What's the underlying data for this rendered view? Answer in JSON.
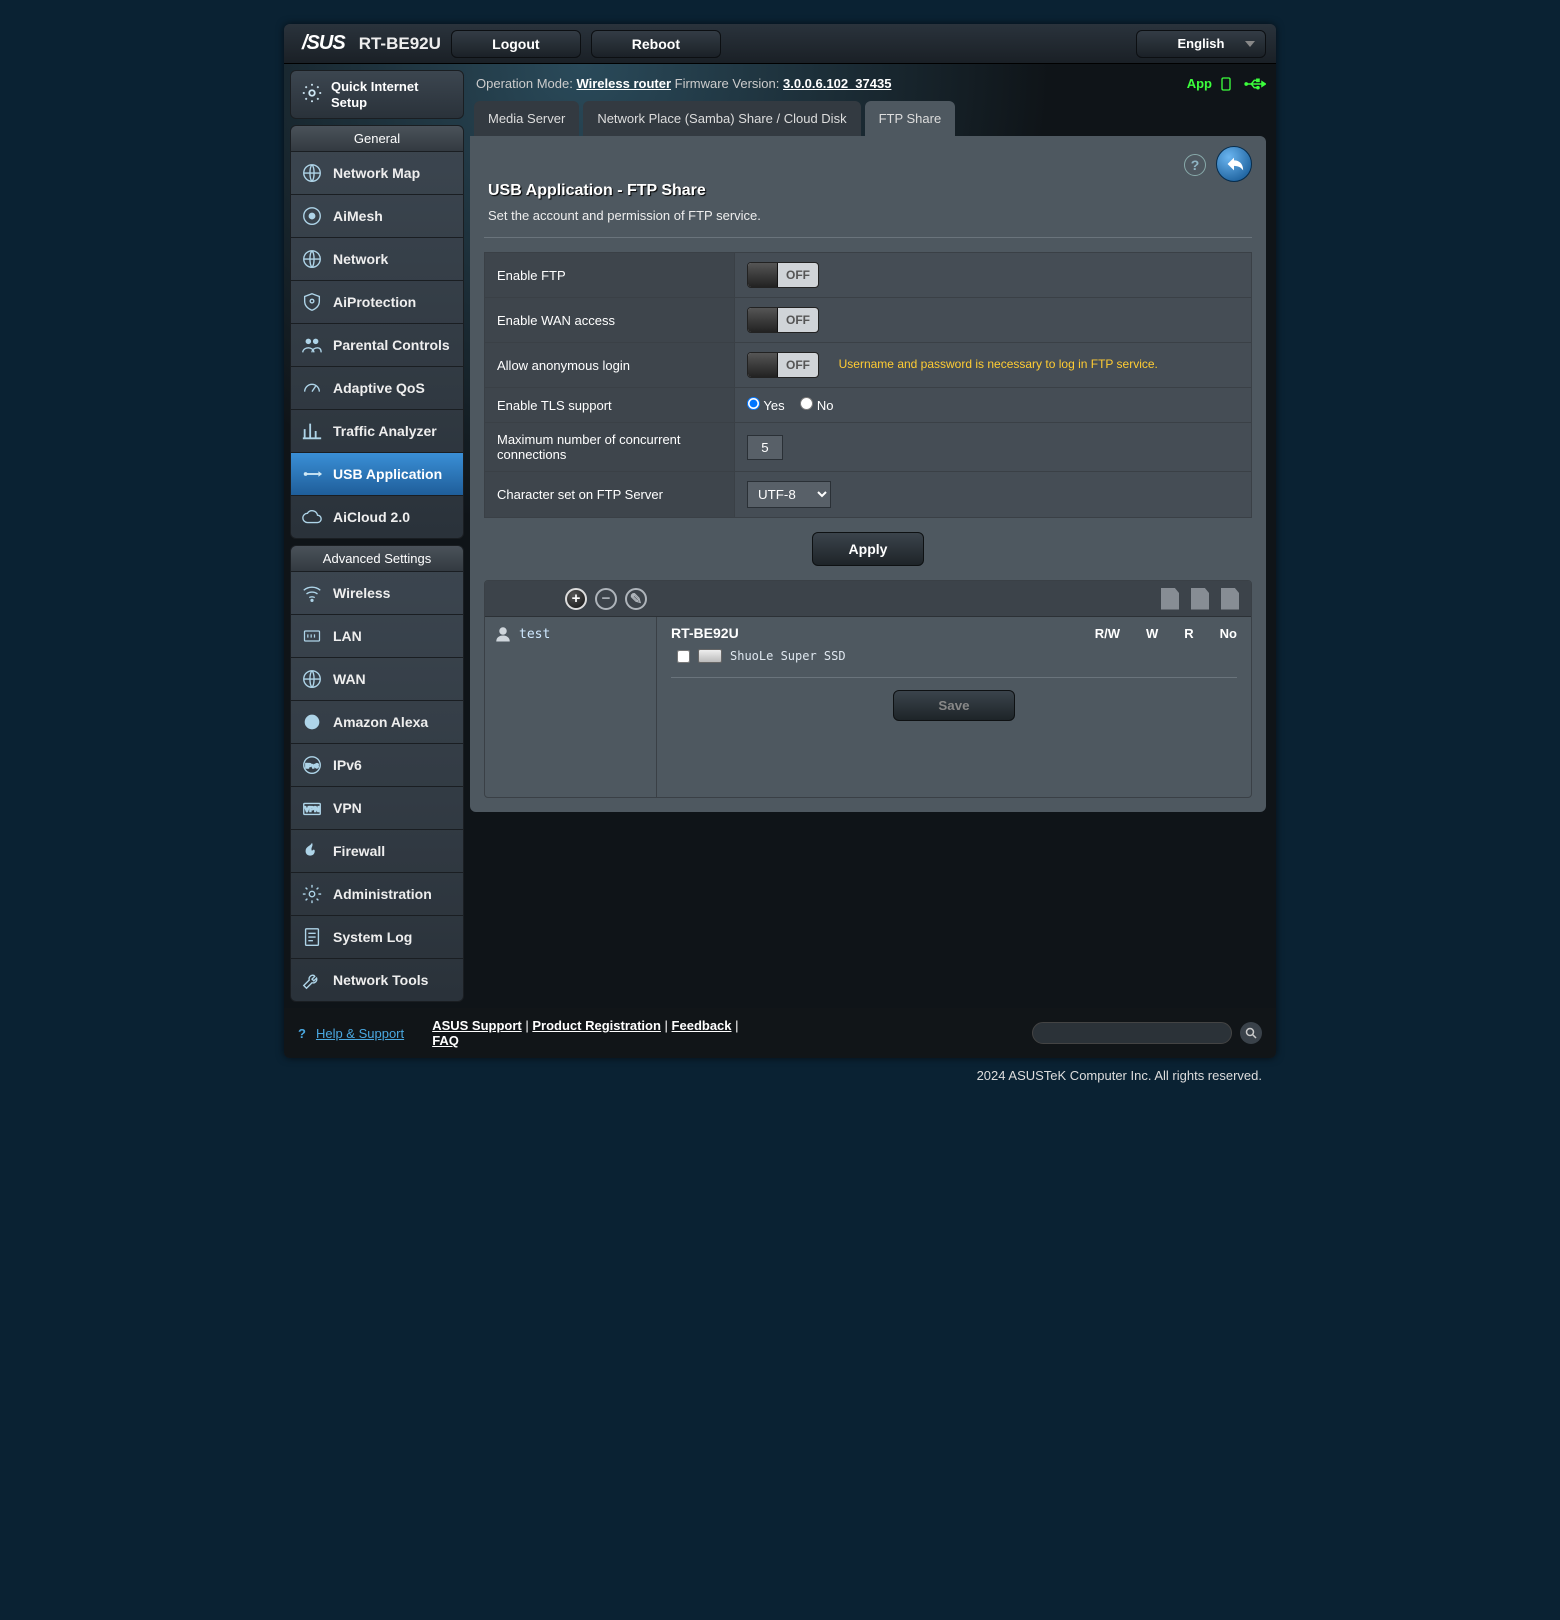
{
  "header": {
    "brand": "/SUS",
    "model": "RT-BE92U",
    "logout": "Logout",
    "reboot": "Reboot",
    "language": "English"
  },
  "opline": {
    "mode_label": "Operation Mode:",
    "mode_value": "Wireless router",
    "fw_label": "Firmware Version:",
    "fw_value": "3.0.0.6.102_37435",
    "app": "App"
  },
  "side": {
    "qis": "Quick Internet\nSetup",
    "general_title": "General",
    "general": [
      {
        "label": "Network Map",
        "icon": "globe"
      },
      {
        "label": "AiMesh",
        "icon": "mesh"
      },
      {
        "label": "Network",
        "icon": "globe"
      },
      {
        "label": "AiProtection",
        "icon": "shield"
      },
      {
        "label": "Parental Controls",
        "icon": "people"
      },
      {
        "label": "Adaptive QoS",
        "icon": "gauge"
      },
      {
        "label": "Traffic Analyzer",
        "icon": "chart"
      },
      {
        "label": "USB Application",
        "icon": "usb",
        "active": true
      },
      {
        "label": "AiCloud 2.0",
        "icon": "cloud"
      }
    ],
    "advanced_title": "Advanced Settings",
    "advanced": [
      {
        "label": "Wireless",
        "icon": "wifi"
      },
      {
        "label": "LAN",
        "icon": "lan"
      },
      {
        "label": "WAN",
        "icon": "globe"
      },
      {
        "label": "Amazon Alexa",
        "icon": "alexa"
      },
      {
        "label": "IPv6",
        "icon": "ipv6"
      },
      {
        "label": "VPN",
        "icon": "vpn"
      },
      {
        "label": "Firewall",
        "icon": "fire"
      },
      {
        "label": "Administration",
        "icon": "gear"
      },
      {
        "label": "System Log",
        "icon": "log"
      },
      {
        "label": "Network Tools",
        "icon": "tools"
      }
    ]
  },
  "tabs": [
    {
      "label": "Media Server"
    },
    {
      "label": "Network Place (Samba) Share / Cloud Disk"
    },
    {
      "label": "FTP Share",
      "active": true
    }
  ],
  "panel": {
    "title": "USB Application - FTP Share",
    "desc": "Set the account and permission of FTP service.",
    "rows": {
      "enable_ftp": {
        "label": "Enable FTP",
        "value": "OFF"
      },
      "enable_wan": {
        "label": "Enable WAN access",
        "value": "OFF"
      },
      "anon": {
        "label": "Allow anonymous login",
        "value": "OFF",
        "hint": "Username and password is necessary to log in FTP service."
      },
      "tls": {
        "label": "Enable TLS support",
        "yes": "Yes",
        "no": "No",
        "selected": "yes"
      },
      "maxconn": {
        "label": "Maximum number of concurrent connections",
        "value": "5"
      },
      "charset": {
        "label": "Character set on FTP Server",
        "value": "UTF-8"
      }
    },
    "apply": "Apply"
  },
  "perm": {
    "user": "test",
    "device": "RT-BE92U",
    "cols": [
      "R/W",
      "W",
      "R",
      "No"
    ],
    "disk": "ShuoLe Super SSD",
    "save": "Save"
  },
  "footer": {
    "help": "Help & Support",
    "links": {
      "support": "ASUS Support",
      "reg": "Product Registration",
      "feedback": "Feedback",
      "faq": "FAQ"
    },
    "copyright": "2024 ASUSTeK Computer Inc. All rights reserved."
  }
}
